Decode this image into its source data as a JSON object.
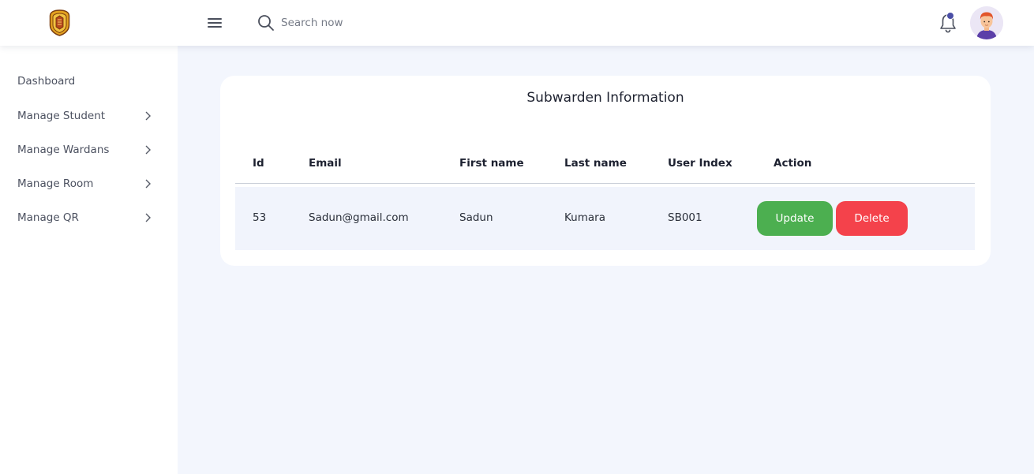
{
  "header": {
    "search_placeholder": "Search now"
  },
  "sidebar": {
    "items": [
      {
        "label": "Dashboard",
        "has_chevron": false
      },
      {
        "label": "Manage Student",
        "has_chevron": true
      },
      {
        "label": "Manage Wardans",
        "has_chevron": true
      },
      {
        "label": "Manage Room",
        "has_chevron": true
      },
      {
        "label": "Manage QR",
        "has_chevron": true
      }
    ]
  },
  "main": {
    "title": "Subwarden Information",
    "table": {
      "columns": [
        "Id",
        "Email",
        "First name",
        "Last name",
        "User Index",
        "Action"
      ],
      "rows": [
        {
          "id": "53",
          "email": "Sadun@gmail.com",
          "first_name": "Sadun",
          "last_name": "Kumara",
          "user_index": "SB001",
          "update_label": "Update",
          "delete_label": "Delete"
        }
      ]
    }
  },
  "colors": {
    "update": "#4caf50",
    "delete": "#f4424b",
    "notification_dot": "#4b4fa6",
    "page_bg": "#f3f6fd"
  },
  "icons": {
    "logo": "university-crest-icon",
    "menu": "hamburger-menu-icon",
    "search": "search-icon",
    "notifications": "bell-icon",
    "avatar": "user-avatar",
    "chevron": "chevron-right-icon"
  }
}
